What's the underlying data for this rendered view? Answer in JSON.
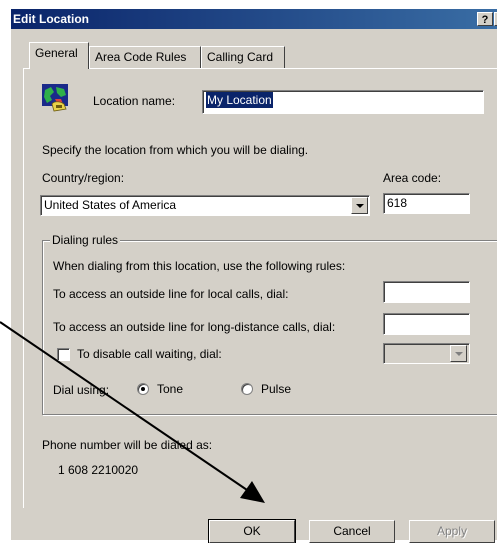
{
  "window": {
    "title": "Edit Location",
    "help_label": "?",
    "close_label": "×"
  },
  "tabs": [
    {
      "label": "General",
      "active": true
    },
    {
      "label": "Area Code Rules",
      "active": false
    },
    {
      "label": "Calling Card",
      "active": false
    }
  ],
  "general": {
    "location_name_label": "Location name:",
    "location_name_value": "My Location",
    "specify_text": "Specify the location from which you will be dialing.",
    "country_label": "Country/region:",
    "country_value": "United States of America",
    "area_code_label": "Area code:",
    "area_code_value": "618"
  },
  "dialing_rules": {
    "group_label": "Dialing rules",
    "intro_text": "When dialing from this location, use the following rules:",
    "local_label": "To access an outside line for local calls, dial:",
    "local_value": "",
    "long_distance_label": "To access an outside line for long-distance calls, dial:",
    "long_distance_value": "",
    "disable_call_waiting_label": "To disable call waiting, dial:",
    "disable_call_waiting_checked": false,
    "call_waiting_value": "",
    "dial_using_label": "Dial using:",
    "tone_label": "Tone",
    "pulse_label": "Pulse",
    "selected_mode": "Tone"
  },
  "phone_preview": {
    "label": "Phone number will be dialed as:",
    "number": "1 608 2210020"
  },
  "buttons": {
    "ok": "OK",
    "cancel": "Cancel",
    "apply": "Apply"
  },
  "colors": {
    "dialog_bg": "#d4d0c8",
    "title_bar": "#0a246a",
    "selection": "#0a246a",
    "annotation_arrow": "#000000"
  },
  "icons": {
    "location": "location-globe-phone-icon"
  }
}
